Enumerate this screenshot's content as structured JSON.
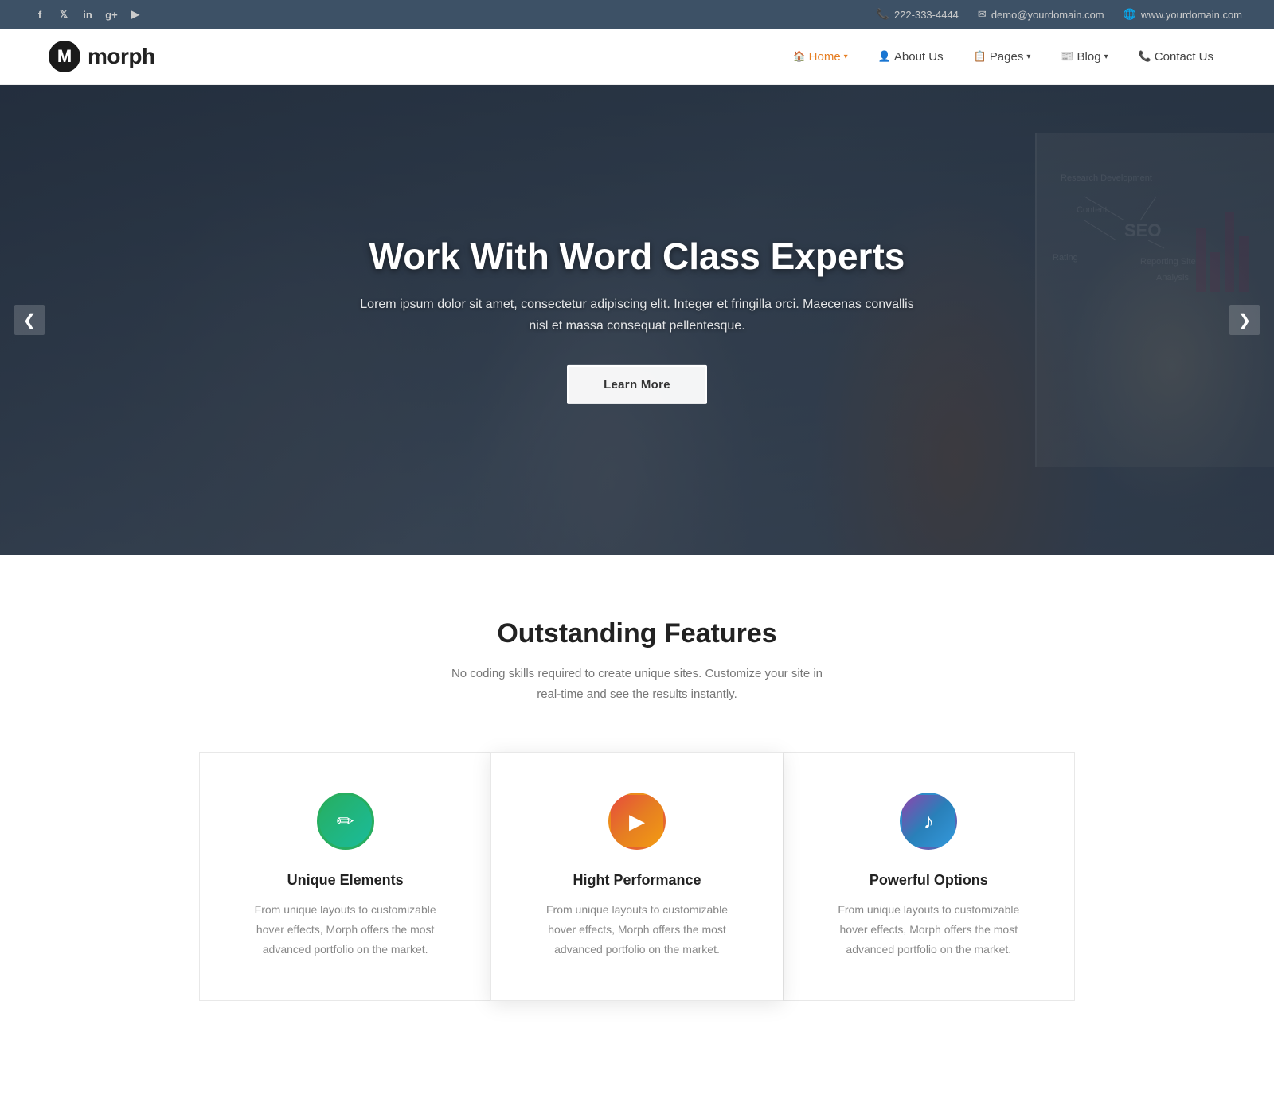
{
  "topbar": {
    "social": {
      "facebook": "f",
      "twitter": "t",
      "linkedin": "in",
      "googleplus": "g+",
      "youtube": "▶"
    },
    "phone_icon": "📞",
    "phone": "222-333-4444",
    "email_icon": "✉",
    "email": "demo@yourdomain.com",
    "globe_icon": "🌐",
    "website": "www.yourdomain.com"
  },
  "header": {
    "logo_text": "morph",
    "nav": [
      {
        "id": "home",
        "label": "Home",
        "icon": "🏠",
        "has_dropdown": true,
        "active": true
      },
      {
        "id": "about",
        "label": "About Us",
        "icon": "👤",
        "has_dropdown": false,
        "active": false
      },
      {
        "id": "pages",
        "label": "Pages",
        "icon": "📋",
        "has_dropdown": true,
        "active": false
      },
      {
        "id": "blog",
        "label": "Blog",
        "icon": "📰",
        "has_dropdown": true,
        "active": false
      },
      {
        "id": "contact",
        "label": "Contact Us",
        "icon": "📞",
        "has_dropdown": false,
        "active": false
      }
    ]
  },
  "hero": {
    "title": "Work With Word Class Experts",
    "subtitle": "Lorem ipsum dolor sit amet, consectetur adipiscing elit. Integer et fringilla orci. Maecenas convallis nisl et massa consequat pellentesque.",
    "cta_label": "Learn More",
    "arrow_left": "❮",
    "arrow_right": "❯"
  },
  "features": {
    "section_title": "Outstanding Features",
    "section_subtitle": "No coding skills required to create unique sites. Customize your site in real-time and see the results instantly.",
    "cards": [
      {
        "id": "unique-elements",
        "icon": "✏",
        "icon_style": "green",
        "title": "Unique Elements",
        "description": "From unique layouts to customizable hover effects, Morph offers the most advanced portfolio on the market."
      },
      {
        "id": "high-performance",
        "icon": "▶",
        "icon_style": "red-orange",
        "title": "Hight Performance",
        "description": "From unique layouts to customizable hover effects, Morph offers the most advanced portfolio on the market."
      },
      {
        "id": "powerful-options",
        "icon": "♪",
        "icon_style": "purple-blue",
        "title": "Powerful Options",
        "description": "From unique layouts to customizable hover effects, Morph offers the most advanced portfolio on the market."
      }
    ]
  }
}
